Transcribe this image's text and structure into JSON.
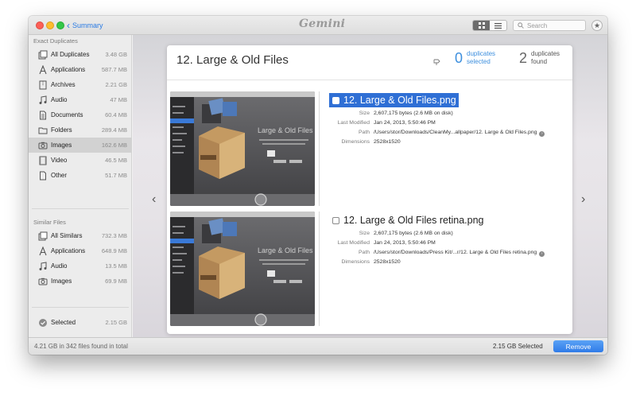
{
  "window": {
    "back_label": "Summary",
    "app_logo": "Gemini",
    "search_placeholder": "Search"
  },
  "sidebar": {
    "exact_title": "Exact Duplicates",
    "exact_items": [
      {
        "label": "All Duplicates",
        "size": "3.48 GB",
        "icon": "stack-icon"
      },
      {
        "label": "Applications",
        "size": "587.7 MB",
        "icon": "applications-icon"
      },
      {
        "label": "Archives",
        "size": "2.21 GB",
        "icon": "archive-icon"
      },
      {
        "label": "Audio",
        "size": "47 MB",
        "icon": "music-note-icon"
      },
      {
        "label": "Documents",
        "size": "60.4 MB",
        "icon": "document-icon"
      },
      {
        "label": "Folders",
        "size": "289.4 MB",
        "icon": "folder-icon"
      },
      {
        "label": "Images",
        "size": "162.6 MB",
        "icon": "camera-icon"
      },
      {
        "label": "Video",
        "size": "46.5 MB",
        "icon": "film-icon"
      },
      {
        "label": "Other",
        "size": "51.7 MB",
        "icon": "file-icon"
      }
    ],
    "similar_title": "Similar Files",
    "similar_items": [
      {
        "label": "All Similars",
        "size": "732.3 MB",
        "icon": "stack-icon"
      },
      {
        "label": "Applications",
        "size": "648.9 MB",
        "icon": "applications-icon"
      },
      {
        "label": "Audio",
        "size": "13.5 MB",
        "icon": "music-note-icon"
      },
      {
        "label": "Images",
        "size": "69.9 MB",
        "icon": "camera-icon"
      }
    ],
    "selected": {
      "label": "Selected",
      "size": "2.15 GB",
      "icon": "checkmark-circle-icon"
    }
  },
  "panel": {
    "title": "12. Large & Old Files",
    "selected_count": "0",
    "selected_label_1": "duplicates",
    "selected_label_2": "selected",
    "found_count": "2",
    "found_label_1": "duplicates",
    "found_label_2": "found"
  },
  "entries": [
    {
      "name": "12. Large & Old Files.png",
      "selected": true,
      "labels": {
        "size": "Size",
        "modified": "Last Modified",
        "path": "Path",
        "dimensions": "Dimensions"
      },
      "size": "2,607,175 bytes (2.6 MB on disk)",
      "modified": "Jan 24, 2013, 5:50:46 PM",
      "path": "/Users/stor/Downloads/CleanMy...allpaper/12. Large & Old Files.png",
      "dimensions": "2528x1520",
      "thumb_caption": "Large & Old Files"
    },
    {
      "name": "12. Large & Old Files retina.png",
      "selected": false,
      "labels": {
        "size": "Size",
        "modified": "Last Modified",
        "path": "Path",
        "dimensions": "Dimensions"
      },
      "size": "2,607,175 bytes (2.6 MB on disk)",
      "modified": "Jan 24, 2013, 5:50:46 PM",
      "path": "/Users/stor/Downloads/Press Kit/...r/12. Large & Old Files retina.png",
      "dimensions": "2528x1520",
      "thumb_caption": "Large & Old Files"
    }
  ],
  "statusbar": {
    "summary": "4.21 GB in 342 files found in total",
    "selected_size": "2.15 GB Selected",
    "remove_label": "Remove"
  },
  "colors": {
    "accent": "#2f7be8",
    "selection": "#2f6fd5",
    "stat_blue": "#3d8fde"
  }
}
